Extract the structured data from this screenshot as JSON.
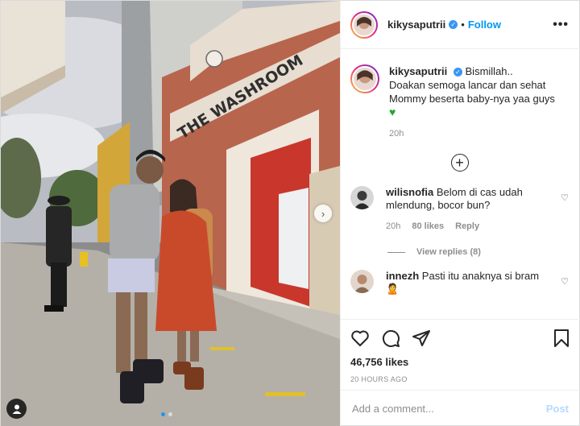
{
  "post": {
    "username": "kikysaputrii",
    "follow_label": "Follow",
    "more_label": "•••",
    "caption_lines": [
      "Bismillah..",
      "Doakan semoga lancar dan sehat",
      "Mommy beserta baby-nya yaa guys"
    ],
    "caption_emoji": "♥",
    "caption_time": "20h",
    "photo_sign": "THE WASHROOM",
    "likes": "46,756 likes",
    "posted_ago": "20 HOURS AGO"
  },
  "comments": [
    {
      "username": "wilisnofia",
      "text": "Belom di cas udah mlendung, bocor bun?",
      "time": "20h",
      "likes": "80 likes",
      "reply_label": "Reply",
      "view_replies": "View replies (8)"
    },
    {
      "username": "innezh",
      "text": "Pasti itu anaknya si bram",
      "emoji": "🙎"
    }
  ],
  "composer": {
    "placeholder": "Add a comment...",
    "post_label": "Post"
  },
  "icons": {
    "like": "heart-outline",
    "comment": "speech-bubble",
    "share": "paper-plane",
    "save": "bookmark",
    "load_more": "plus-circle",
    "next": "chevron-right",
    "tag": "user-silhouette"
  },
  "colors": {
    "link_blue": "#0095f6",
    "post_disabled": "#b3dbff",
    "verified": "#3897f0",
    "meta_gray": "#8e8e8e"
  }
}
